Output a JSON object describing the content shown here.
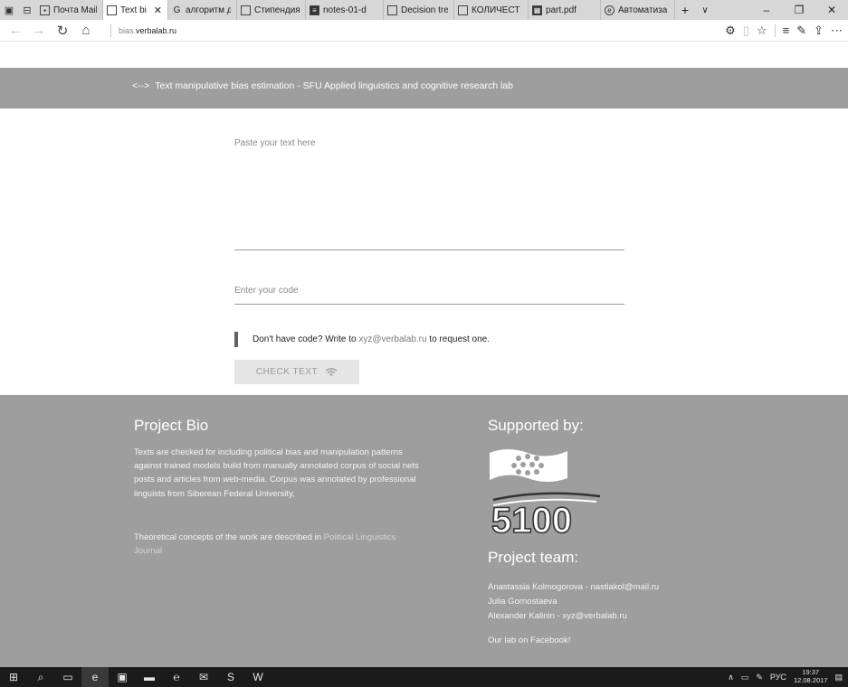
{
  "browser": {
    "tabs": [
      {
        "label": "Почта Mail",
        "icon": "mail-icon",
        "active": false
      },
      {
        "label": "Text bia",
        "icon": "page-icon",
        "active": true
      },
      {
        "label": "алгоритм д",
        "icon": "google-icon",
        "active": false
      },
      {
        "label": "Стипендия",
        "icon": "doc-icon",
        "active": false
      },
      {
        "label": "notes-01-d",
        "icon": "doc-dark-icon",
        "active": false
      },
      {
        "label": "Decision tre",
        "icon": "page-icon",
        "active": false
      },
      {
        "label": "КОЛИЧЕСТ",
        "icon": "page-icon",
        "active": false
      },
      {
        "label": "part.pdf",
        "icon": "pdf-icon",
        "active": false
      },
      {
        "label": "Автоматиза",
        "icon": "edge-icon",
        "active": false
      }
    ],
    "address": {
      "subdomain": "bias.",
      "domain": "verbalab.ru"
    }
  },
  "header": {
    "logo": "<-->",
    "title": "Text manipulative bias estimation - SFU Applied linguistics and cognitive research lab"
  },
  "form": {
    "text_placeholder": "Paste your text here",
    "code_placeholder": "Enter your code",
    "notice_prefix": "Don't have code? Write to ",
    "notice_email": "xyz@verbalab.ru",
    "notice_suffix": " to request one.",
    "check_button": "CHECK TEXT"
  },
  "footer": {
    "bio_title": "Project Bio",
    "bio_text": "Texts are checked for including political bias and manipulation patterns against trained models build from manually annotated corpus of social nets posts and articles from web-media. Corpus was annotated by professional linguists from Siberean Federal University,",
    "concepts_prefix": "Theoretical concepts of the work are described in ",
    "concepts_link": "Political Linguistics Journal",
    "supported_title": "Supported by:",
    "logo_text": "5100",
    "team_title": "Project team:",
    "team": [
      "Anastassia Kolmogorova - nastiakol@mail.ru",
      "Julia Gornostaeva",
      "Alexander Kalinin - xyz@verbalab.ru"
    ],
    "facebook_link": "Our lab on Facebook!"
  },
  "taskbar": {
    "language": "РУС",
    "time": "19:37",
    "date": "12.08.2017"
  }
}
